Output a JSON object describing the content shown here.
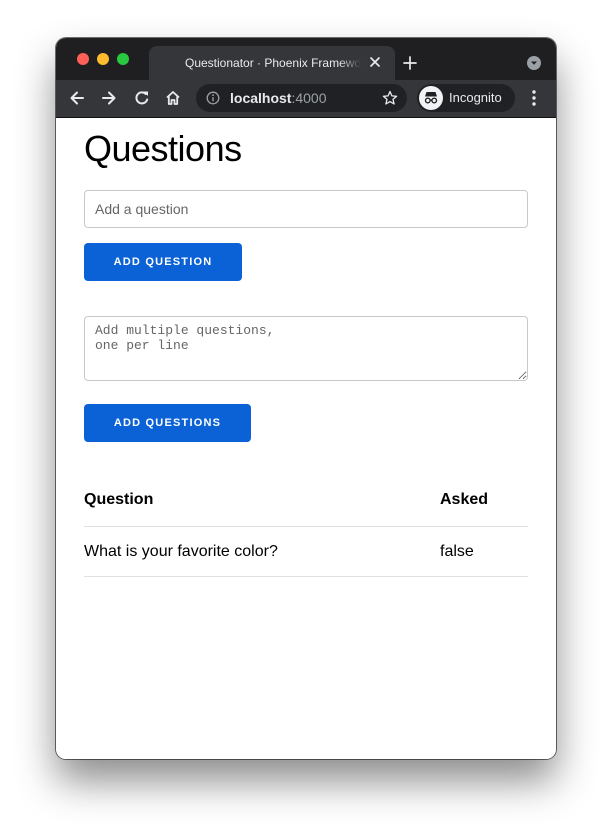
{
  "browser": {
    "tab_title": "Questionator · Phoenix Framework",
    "url_host": "localhost",
    "url_port": ":4000",
    "profile_label": "Incognito"
  },
  "page": {
    "title": "Questions",
    "single_form": {
      "placeholder": "Add a question",
      "value": "",
      "button_label": "ADD QUESTION"
    },
    "multi_form": {
      "placeholder": "Add multiple questions,\none per line",
      "value": "",
      "button_label": "ADD QUESTIONS"
    },
    "table": {
      "headers": [
        "Question",
        "Asked"
      ],
      "rows": [
        [
          "What is your favorite color?",
          "false"
        ]
      ]
    }
  },
  "colors": {
    "accent": "#0a62d6",
    "chrome_dark": "#1f1f22",
    "chrome_toolbar": "#35363a"
  },
  "icons": [
    "back-arrow-icon",
    "forward-arrow-icon",
    "reload-icon",
    "home-icon",
    "info-icon",
    "star-icon",
    "incognito-icon",
    "menu-dots-icon",
    "close-icon",
    "plus-icon",
    "tab-search-icon"
  ]
}
